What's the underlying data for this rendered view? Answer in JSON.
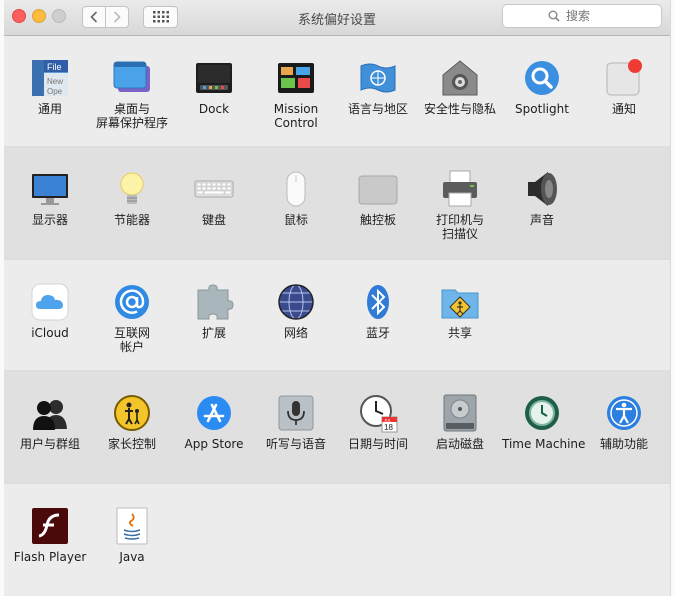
{
  "window": {
    "title": "系统偏好设置",
    "search_placeholder": "搜索"
  },
  "rows": [
    {
      "items": [
        {
          "key": "general",
          "label": "通用",
          "label2": ""
        },
        {
          "key": "desktop",
          "label": "桌面与",
          "label2": "屏幕保护程序"
        },
        {
          "key": "dock",
          "label": "Dock",
          "label2": ""
        },
        {
          "key": "mission",
          "label": "Mission",
          "label2": "Control"
        },
        {
          "key": "language",
          "label": "语言与地区",
          "label2": ""
        },
        {
          "key": "security",
          "label": "安全性与隐私",
          "label2": ""
        },
        {
          "key": "spotlight",
          "label": "Spotlight",
          "label2": ""
        },
        {
          "key": "notifications",
          "label": "通知",
          "label2": ""
        }
      ]
    },
    {
      "items": [
        {
          "key": "displays",
          "label": "显示器",
          "label2": ""
        },
        {
          "key": "energy",
          "label": "节能器",
          "label2": ""
        },
        {
          "key": "keyboard",
          "label": "键盘",
          "label2": ""
        },
        {
          "key": "mouse",
          "label": "鼠标",
          "label2": ""
        },
        {
          "key": "trackpad",
          "label": "触控板",
          "label2": ""
        },
        {
          "key": "printers",
          "label": "打印机与",
          "label2": "扫描仪"
        },
        {
          "key": "sound",
          "label": "声音",
          "label2": ""
        }
      ]
    },
    {
      "items": [
        {
          "key": "icloud",
          "label": "iCloud",
          "label2": ""
        },
        {
          "key": "internet",
          "label": "互联网",
          "label2": "帐户"
        },
        {
          "key": "extensions",
          "label": "扩展",
          "label2": ""
        },
        {
          "key": "network",
          "label": "网络",
          "label2": ""
        },
        {
          "key": "bluetooth",
          "label": "蓝牙",
          "label2": ""
        },
        {
          "key": "sharing",
          "label": "共享",
          "label2": ""
        }
      ]
    },
    {
      "items": [
        {
          "key": "users",
          "label": "用户与群组",
          "label2": ""
        },
        {
          "key": "parental",
          "label": "家长控制",
          "label2": ""
        },
        {
          "key": "appstore",
          "label": "App Store",
          "label2": ""
        },
        {
          "key": "dictation",
          "label": "听写与语音",
          "label2": ""
        },
        {
          "key": "datetime",
          "label": "日期与时间",
          "label2": ""
        },
        {
          "key": "startup",
          "label": "启动磁盘",
          "label2": ""
        },
        {
          "key": "timemachine",
          "label": "Time Machine",
          "label2": ""
        },
        {
          "key": "accessibility",
          "label": "辅助功能",
          "label2": ""
        }
      ]
    },
    {
      "items": [
        {
          "key": "flash",
          "label": "Flash Player",
          "label2": ""
        },
        {
          "key": "java",
          "label": "Java",
          "label2": ""
        }
      ]
    }
  ],
  "icon_text": {
    "general_file": "File",
    "general_new": "New",
    "general_open": "Ope",
    "calendar_day": "18",
    "calendar_month": "JUL"
  }
}
